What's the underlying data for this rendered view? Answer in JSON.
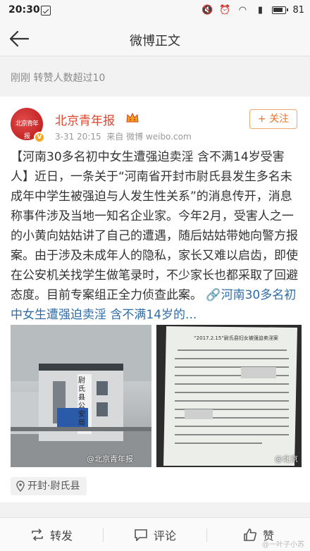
{
  "status_bar": {
    "time": "20:30",
    "battery": "81"
  },
  "title_bar": {
    "title": "微博正文"
  },
  "notice": {
    "text": "刚刚 转赞人数超过10"
  },
  "post": {
    "author": "北京青年报",
    "avatar_text": "北京青年报",
    "time": "3-31 20:15",
    "source": "来自 微博 weibo.com",
    "follow_label": "+ 关注",
    "body": "【河南30多名初中女生遭强迫卖淫 含不满14岁受害人】近日，一条关于“河南省开封市尉氏县发生多名未成年中学生被强迫与人发生性关系”的消息传开，消息称事件涉及当地一知名企业家。今年2月，受害人之一的小黄向姑姑讲了自己的遭遇，随后姑姑带她向警方报案。由于涉及未成年人的隐私，家长又难以启齿，即使在公安机关找学生做笔录时，不少家长也都采取了回避态度。目前专案组正全力侦查此案。",
    "link_text": "🔗河南30多名初中女生遭强迫卖淫 含不满14岁的...",
    "image1_watermark": "@北京青年报",
    "image2_watermark": "@北京",
    "image1_sign": "尉氏县公安局",
    "image2_doc_title": "“2017.2.15”尉氏县妇女被强迫卖淫案",
    "location": "开封·尉氏县"
  },
  "bottom_bar": {
    "repost": "转发",
    "comment": "评论",
    "like": "赞"
  },
  "corner_watermark": "@一叶子小苏",
  "colors": {
    "accent": "#e8742c",
    "username": "#e0452f",
    "link": "#2e6ca8"
  }
}
